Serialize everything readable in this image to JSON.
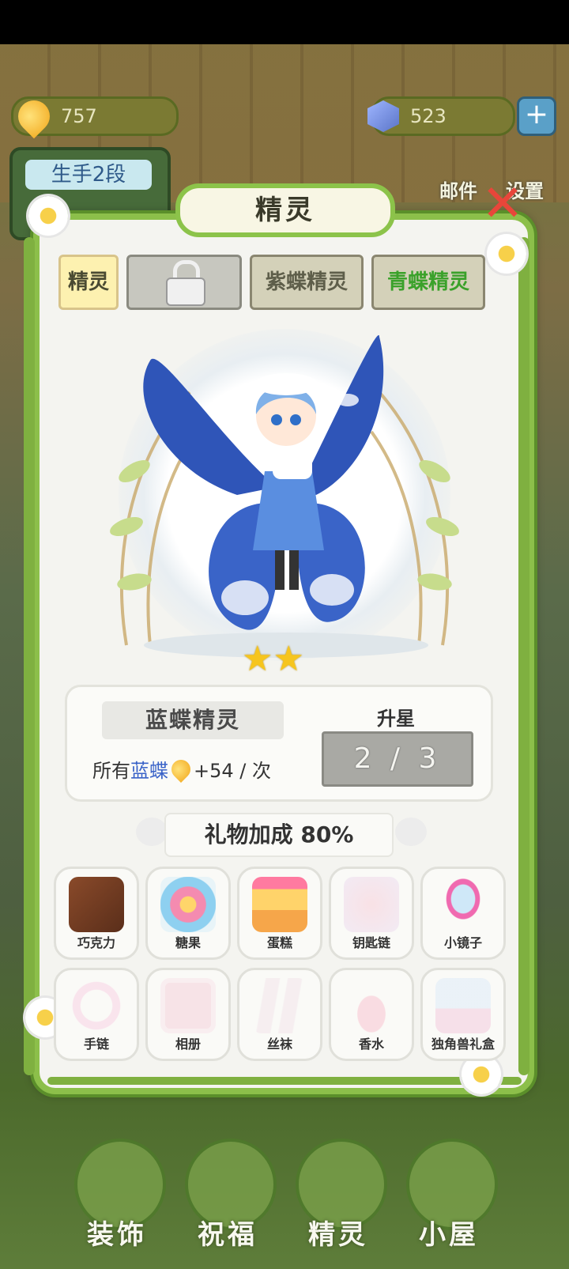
{
  "hud": {
    "gold_amount": "757",
    "gem_amount": "523",
    "plus_icon": "plus-icon",
    "rank_label": "生手2段",
    "mail_label": "邮件",
    "settings_label": "设置"
  },
  "panel": {
    "title": "精灵",
    "close_icon": "close-icon",
    "tabs": [
      {
        "label": "精灵",
        "state": "active"
      },
      {
        "label": "",
        "state": "locked"
      },
      {
        "label": "紫蝶精灵",
        "state": "normal"
      },
      {
        "label": "青蝶精灵",
        "state": "green"
      }
    ],
    "stars": 2,
    "spirit_name": "蓝蝶精灵",
    "bonus_prefix": "所有",
    "bonus_target": "蓝蝶",
    "bonus_suffix": "+54 / 次",
    "upgrade_label": "升星",
    "upgrade_progress": "2 / 3",
    "gift_bonus": "礼物加成 80%",
    "gifts": [
      {
        "label": "巧克力",
        "owned": true
      },
      {
        "label": "糖果",
        "owned": true
      },
      {
        "label": "蛋糕",
        "owned": true
      },
      {
        "label": "钥匙链",
        "owned": false
      },
      {
        "label": "小镜子",
        "owned": true
      },
      {
        "label": "手链",
        "owned": false
      },
      {
        "label": "相册",
        "owned": false
      },
      {
        "label": "丝袜",
        "owned": false
      },
      {
        "label": "香水",
        "owned": false
      },
      {
        "label": "独角兽礼盒",
        "owned": false
      }
    ]
  },
  "nav": [
    {
      "label": "装饰"
    },
    {
      "label": "祝福"
    },
    {
      "label": "精灵"
    },
    {
      "label": "小屋"
    }
  ],
  "colors": {
    "panel_border": "#8cbf4a",
    "star": "#f6c51e",
    "bonus_blue": "#3a63c8",
    "tab_green": "#3aa12a",
    "close_red": "#e8463a"
  }
}
